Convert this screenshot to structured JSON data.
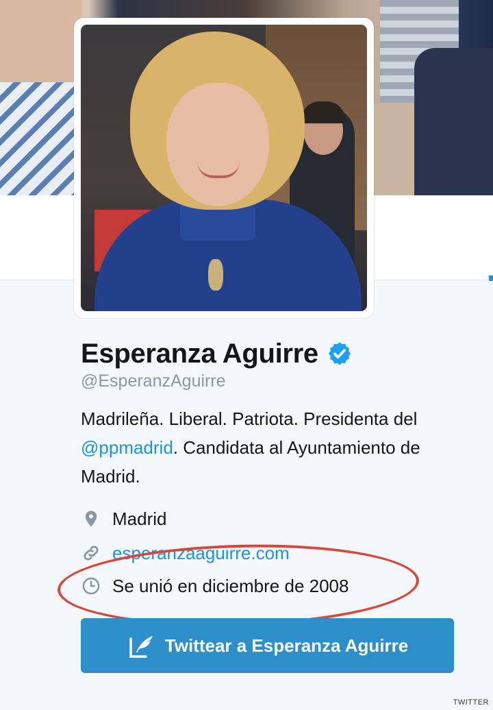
{
  "profile": {
    "name": "Esperanza Aguirre",
    "handle": "@EsperanzAguirre",
    "bio_part1": "Madrileña. Liberal. Patriota. Presidenta del ",
    "bio_mention": "@ppmadrid",
    "bio_part2": ". Candidata al Ayuntamiento de Madrid.",
    "location": "Madrid",
    "website": "esperanzaaguirre.com",
    "joined": "Se unió en diciembre de 2008",
    "tweet_button_label": "Twittear a Esperanza Aguirre"
  },
  "credit": "TWITTER",
  "icons": {
    "verified": "verified-badge-icon",
    "location": "location-pin-icon",
    "website": "link-icon",
    "joined": "clock-icon",
    "tweet": "compose-tweet-icon"
  },
  "colors": {
    "accent": "#1b95e0",
    "button": "#2d8fc9",
    "highlight": "#d8473d",
    "text": "#14171a",
    "muted": "#8899a6"
  }
}
